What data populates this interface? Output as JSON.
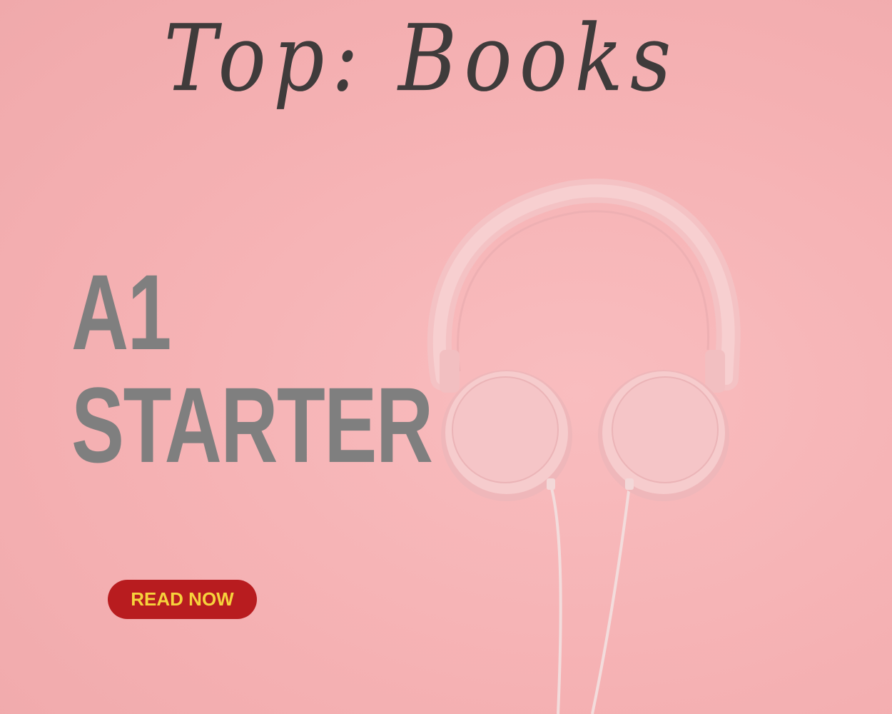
{
  "headline": "Top:  Books",
  "title": {
    "line1": "A1",
    "line2": "STARTER"
  },
  "cta": {
    "label": "READ NOW"
  },
  "image": {
    "icon": "headphones-icon"
  },
  "colors": {
    "background": "#f6b6b8",
    "headline_text": "#3f3b3b",
    "title_text": "#7f7f7f",
    "button_bg": "#b81c1f",
    "button_text": "#f6d33c",
    "headphones": "#f5c4c6"
  }
}
